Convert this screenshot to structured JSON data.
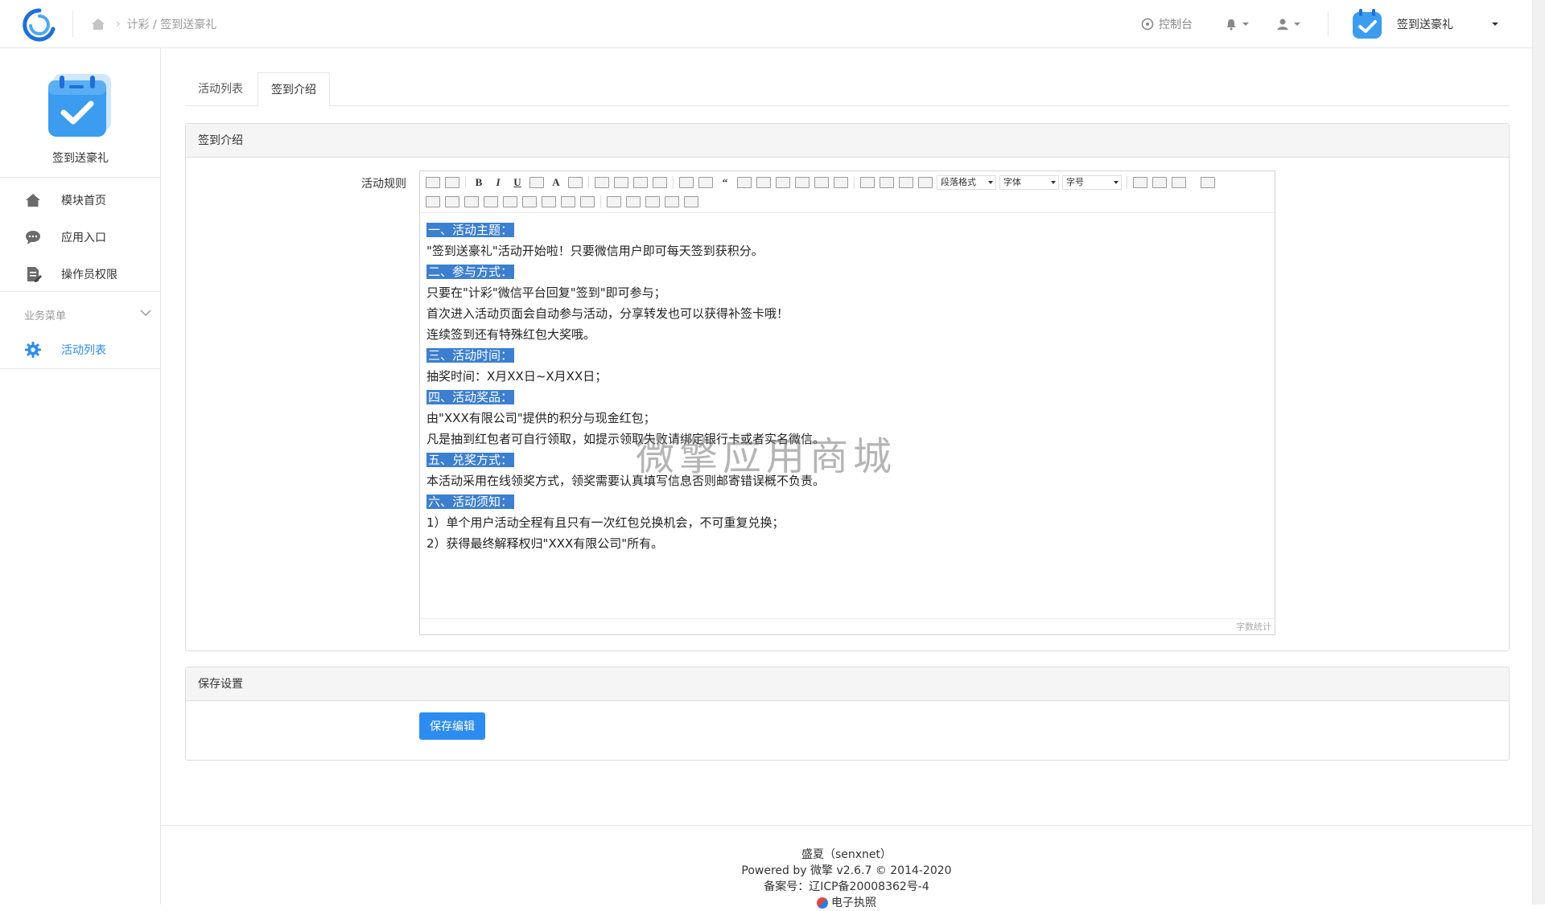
{
  "header": {
    "breadcrumb_text": "计彩 / 签到送豪礼",
    "console_label": "控制台",
    "account_name": "签到送豪礼"
  },
  "sidebar": {
    "app_name": "签到送豪礼",
    "items": [
      {
        "label": "模块首页",
        "icon": "home-icon"
      },
      {
        "label": "应用入口",
        "icon": "chat-icon"
      },
      {
        "label": "操作员权限",
        "icon": "document-edit-icon"
      }
    ],
    "group_label": "业务菜单",
    "group_items": [
      {
        "label": "活动列表",
        "icon": "gear-icon",
        "active": true
      }
    ]
  },
  "tabs": [
    {
      "label": "活动列表",
      "active": false
    },
    {
      "label": "签到介绍",
      "active": true
    }
  ],
  "intro_panel": {
    "title": "签到介绍",
    "field_label": "活动规则",
    "toolbar": {
      "paragraph_select": "段落格式",
      "font_select": "字体",
      "size_select": "字号"
    },
    "lines": [
      {
        "text": "一、活动主题：",
        "highlight": true
      },
      {
        "text": "\"签到送豪礼\"活动开始啦！只要微信用户即可每天签到获积分。",
        "highlight": false
      },
      {
        "text": "二、参与方式：",
        "highlight": true
      },
      {
        "text": "只要在\"计彩\"微信平台回复\"签到\"即可参与；",
        "highlight": false
      },
      {
        "text": "首次进入活动页面会自动参与活动，分享转发也可以获得补签卡哦！",
        "highlight": false
      },
      {
        "text": "连续签到还有特殊红包大奖哦。",
        "highlight": false
      },
      {
        "text": "三、活动时间：",
        "highlight": true
      },
      {
        "text": "抽奖时间：X月XX日~X月XX日；",
        "highlight": false
      },
      {
        "text": "四、活动奖品：",
        "highlight": true
      },
      {
        "text": "由\"XXX有限公司\"提供的积分与现金红包；",
        "highlight": false
      },
      {
        "text": "凡是抽到红包者可自行领取，如提示领取失败请绑定银行卡或者实名微信。",
        "highlight": false
      },
      {
        "text": "五、兑奖方式：",
        "highlight": true
      },
      {
        "text": "本活动采用在线领奖方式，领奖需要认真填写信息否则邮寄错误概不负责。",
        "highlight": false
      },
      {
        "text": "六、活动须知：",
        "highlight": true
      },
      {
        "text": "1）单个用户活动全程有且只有一次红包兑换机会，不可重复兑换；",
        "highlight": false
      },
      {
        "text": "2）获得最终解释权归\"XXX有限公司\"所有。",
        "highlight": false
      }
    ],
    "word_count_label": "字数统计"
  },
  "watermark": "微擎应用商城",
  "save_panel": {
    "title": "保存设置",
    "button_label": "保存编辑"
  },
  "footer": {
    "line1": "盛夏（senxnet）",
    "line2": "Powered by 微擎 v2.6.7 © 2014-2020",
    "line3": "备案号：辽ICP备20008362号-4",
    "line4": "电子执照"
  },
  "colors": {
    "accent": "#2d8cf0",
    "highlight": "#3c7fd0",
    "app_icon": "#3b9cf0"
  }
}
